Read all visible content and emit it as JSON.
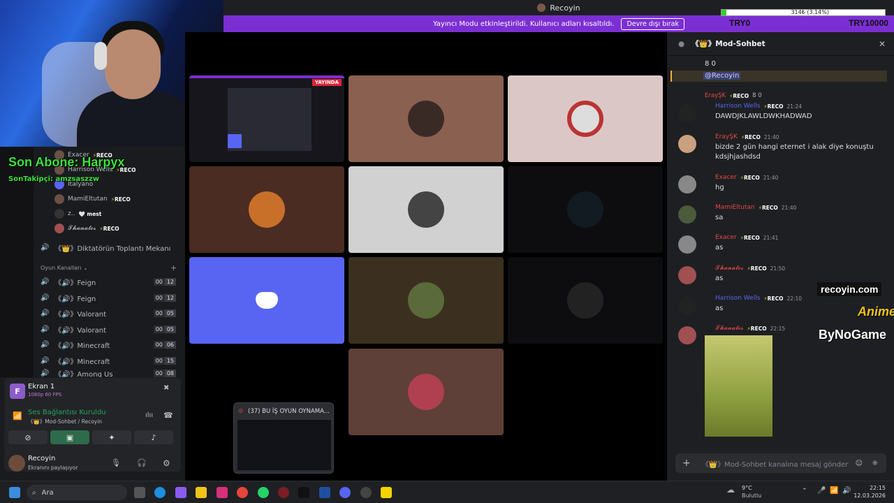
{
  "window": {
    "title": "Recoyin"
  },
  "banner": {
    "text": "Yayıncı Modu etkinleştirildi. Kullanıcı adları kısaltıldı.",
    "button": "Devre dışı bırak"
  },
  "stream_overlay": {
    "progress_text": "314₺ (3.14%)",
    "progress_fraction": 0.0314,
    "left_label": "TRY0",
    "right_label": "TRY10000",
    "last_sub": "Son Abone: Harpyx",
    "last_follow": "SonTakipçi: amzsaszzw",
    "brands": [
      "recoyin.com",
      "Anime",
      "ByNoGame"
    ]
  },
  "left_panel": {
    "voice_users": [
      {
        "name": "Exacer",
        "tag": "RECO"
      },
      {
        "name": "Harrison Wells",
        "tag": "RECO"
      },
      {
        "name": "Italyano",
        "tag": ""
      },
      {
        "name": "MamiEltutan",
        "tag": "RECO"
      },
      {
        "name": "z..",
        "tag": "mest"
      },
      {
        "name": "𝓣𝓱𝓪𝓷𝓪𝓽𝓸𝓼",
        "tag": "RECO"
      }
    ],
    "meeting_channel": "《👑》Diktatörün Toplantı Mekanı",
    "category": "Oyun Kanalları",
    "channels": [
      {
        "name": "《🔊》Feign",
        "a": "00",
        "b": "12"
      },
      {
        "name": "《🔊》Feign",
        "a": "00",
        "b": "12"
      },
      {
        "name": "《🔊》Valorant",
        "a": "00",
        "b": "05"
      },
      {
        "name": "《🔊》Valorant",
        "a": "00",
        "b": "05"
      },
      {
        "name": "《🔊》Minecraft",
        "a": "00",
        "b": "06"
      },
      {
        "name": "《🔊》Minecraft",
        "a": "00",
        "b": "15"
      },
      {
        "name": "《🔊》Among Us",
        "a": "00",
        "b": "08"
      }
    ],
    "screen": {
      "title": "Ekran 1",
      "quality": "1080p 60 FPS"
    },
    "connection": {
      "status": "Ses Bağlantısı Kuruldu",
      "channel": "《👑》Mod-Sohbet / Recoyin"
    },
    "user": {
      "name": "Recoyin",
      "status": "Ekranını paylaşıyor"
    }
  },
  "main": {
    "live_badge": "YAYINDA",
    "popup_title": "(37) BU İŞ OYUN OYNAMA..."
  },
  "chat": {
    "channel": "《👑》Mod-Sohbet",
    "top_lines": [
      "8 0",
      "@Recoyin"
    ],
    "reply": {
      "name": "ErayŞK",
      "tag": "RECO",
      "text": "8 0"
    },
    "messages": [
      {
        "name": "Harrison Wells",
        "color": "#5865f2",
        "time": "21:24",
        "text": "DAWDJKLAWLDWKHADWAD"
      },
      {
        "name": "ErayŞK",
        "color": "#e24848",
        "time": "21:40",
        "text": "bizde 2 gün hangi eternet i alak diye konuştu",
        "text2": "kdsjhjashdsd"
      },
      {
        "name": "Exacer",
        "color": "#e24848",
        "time": "21:40",
        "text": "hg"
      },
      {
        "name": "MamiEltutan",
        "color": "#e24848",
        "time": "21:40",
        "text": "sa"
      },
      {
        "name": "Exacer",
        "color": "#e24848",
        "time": "21:41",
        "text": "as"
      },
      {
        "name": "𝓣𝓱𝓪𝓷𝓪𝓽𝓸𝓼",
        "color": "#e24848",
        "time": "21:50",
        "text": "as"
      },
      {
        "name": "Harrison Wells",
        "color": "#5865f2",
        "time": "22:10",
        "text": "as"
      },
      {
        "name": "𝓣𝓱𝓪𝓷𝓪𝓽𝓸𝓼",
        "color": "#e24848",
        "time": "22:15",
        "text": ""
      }
    ],
    "input_placeholder": "《👑》Mod-Sohbet kanalına mesaj gönder"
  },
  "taskbar": {
    "search": "Ara",
    "weather_temp": "9°C",
    "weather_desc": "Bulutlu",
    "time": "22:15",
    "date": "12.03.2026"
  }
}
